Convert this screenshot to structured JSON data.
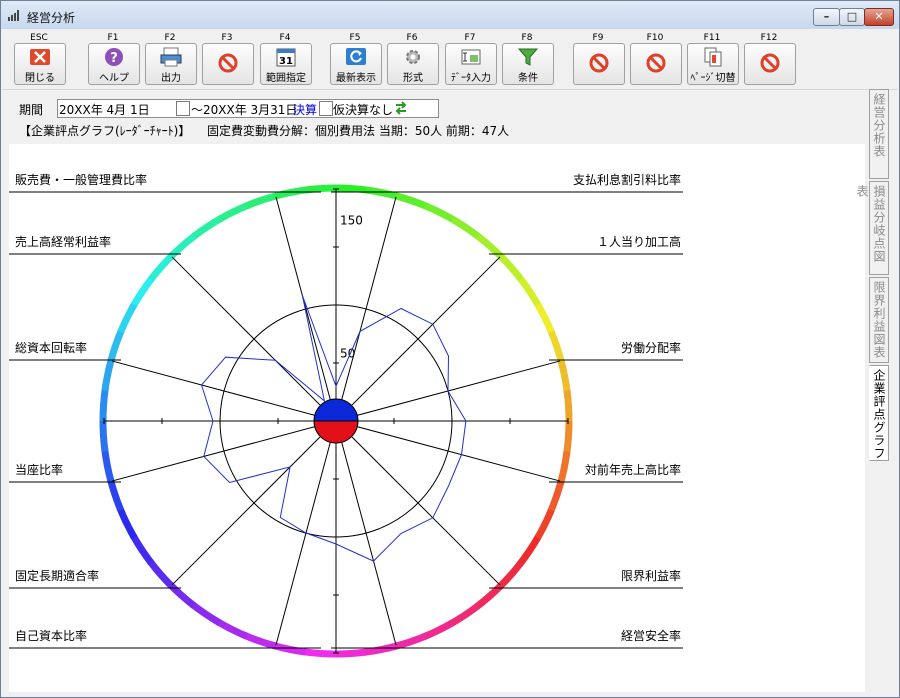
{
  "window": {
    "title": "経営分析"
  },
  "toolbar": {
    "buttons": [
      {
        "key": "ESC",
        "label": "閉じる"
      },
      {
        "key": "F1",
        "label": "ヘルプ"
      },
      {
        "key": "F2",
        "label": "出力"
      },
      {
        "key": "F3",
        "label": ""
      },
      {
        "key": "F4",
        "label": "範囲指定"
      },
      {
        "key": "F5",
        "label": "最新表示"
      },
      {
        "key": "F6",
        "label": "形式"
      },
      {
        "key": "F7",
        "label": "ﾃﾞｰﾀ入力"
      },
      {
        "key": "F8",
        "label": "条件"
      },
      {
        "key": "F9",
        "label": ""
      },
      {
        "key": "F10",
        "label": ""
      },
      {
        "key": "F11",
        "label": "ﾍﾟｰｼﾞ切替"
      },
      {
        "key": "F12",
        "label": ""
      }
    ]
  },
  "period": {
    "label": "期間",
    "from": "20XX年  4月  1日",
    "to": "～20XX年  3月31日",
    "kessan": "決算",
    "kari": "仮決算なし"
  },
  "info": {
    "title": "【企業評点グラフ(ﾚｰﾀﾞｰﾁｬｰﾄ)】",
    "detail": "固定費変動費分解：個別費用法   当期：50人   前期：47人"
  },
  "chart_data": {
    "type": "radar",
    "categories": [
      "支払利息割引料比率",
      "１人当り加工高",
      "労働分配率",
      "対前年売上高比率",
      "限界利益率",
      "経営安全率",
      "自己資本比率",
      "固定長期適合率",
      "当座比率",
      "総資本回転率",
      "売上高経常利益率",
      "販売費・一般管理費比率"
    ],
    "ticks": [
      "150",
      "50"
    ],
    "series": [
      {
        "values": [
          30,
          80,
          112,
          118,
          112,
          100,
          112,
          112,
          112,
          118,
          112,
          125,
          106,
          100,
          96,
          56,
          106,
          118,
          106,
          120,
          110,
          74,
          20,
          112
        ]
      }
    ],
    "colors": {
      "series": "#2030d0",
      "ring": "#000000"
    }
  },
  "side_tabs": [
    "経営分析表",
    "損益分岐点図表",
    "限界利益図表",
    "企業評点グラフ"
  ]
}
